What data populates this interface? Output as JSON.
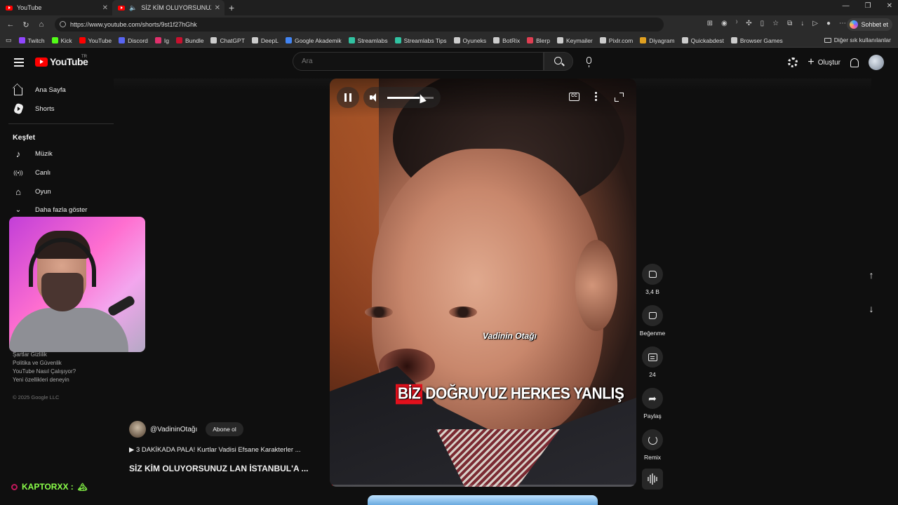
{
  "browser": {
    "tabs": [
      {
        "title": "YouTube",
        "active": false
      },
      {
        "title": "SİZ KİM OLUYORSUNUZ LAN",
        "active": true
      }
    ],
    "url": "https://www.youtube.com/shorts/9st1f27hGhk",
    "copilot_label": "Sohbet et",
    "bookmarks": [
      "Twitch",
      "Kick",
      "YouTube",
      "Discord",
      "Ig",
      "Bundle",
      "ChatGPT",
      "DeepL",
      "Google Akademik",
      "Streamlabs",
      "Streamlabs Tips",
      "Oyuneks",
      "BotRix",
      "Blerp",
      "Keymailer",
      "Pixlr.com",
      "Diyagram",
      "Quickabdest",
      "Browser Games"
    ],
    "bookmark_colors": [
      "#9146ff",
      "#53fc18",
      "#ff0000",
      "#5865f2",
      "#e1306c",
      "#c8102e",
      "#cccccc",
      "#cccccc",
      "#4285f4",
      "#31c3a2",
      "#31c3a2",
      "#cccccc",
      "#cccccc",
      "#e03e52",
      "#cccccc",
      "#cccccc",
      "#e0a020",
      "#cccccc",
      "#cccccc"
    ],
    "other_bookmarks": "Diğer sık kullanılanlar"
  },
  "youtube": {
    "logo_text": "YouTube",
    "region": "TR",
    "search_placeholder": "Ara",
    "create_label": "Oluştur"
  },
  "sidebar": {
    "main": [
      {
        "label": "Ana Sayfa",
        "icon": "home-icon"
      },
      {
        "label": "Shorts",
        "icon": "shorts-icon"
      }
    ],
    "explore_title": "Keşfet",
    "explore": [
      {
        "label": "Müzik",
        "icon": "music-icon",
        "glyph": "♪"
      },
      {
        "label": "Canlı",
        "icon": "live-icon",
        "glyph": "((•))"
      },
      {
        "label": "Oyun",
        "icon": "gamepad-icon",
        "glyph": "⌂"
      }
    ],
    "show_more": "Daha fazla göster",
    "footer": [
      "Şartlar  Gizlilik",
      "Politika ve Güvenlik",
      "YouTube Nasıl Çalışıyor?",
      "Yeni özellikleri deneyin"
    ],
    "copyright": "© 2025 Google LLC"
  },
  "short": {
    "channel": "@VadininOtağı",
    "subscribe": "Abone ol",
    "playlist": "▶ 3 DAKİKADA PALA! Kurtlar Vadisi Efsane Karakterler ...",
    "title": "SİZ KİM OLUYORSUNUZ LAN İSTANBUL'A ...",
    "watermark": "Vadinin Otağı",
    "subtitle_highlight": "BİZ",
    "subtitle_rest": "DOĞRUYUZ HERKES YANLIŞ",
    "cc_label": "CC",
    "volume_fraction": 0.7,
    "progress_fraction": 0.01
  },
  "actions": {
    "like_count": "3,4 B",
    "dislike_label": "Beğenme",
    "comment_count": "24",
    "share_label": "Paylaş",
    "remix_label": "Remix"
  },
  "overlay": {
    "streamer_name": "KAPTORXX :",
    "streamer_emote": "🏔"
  }
}
